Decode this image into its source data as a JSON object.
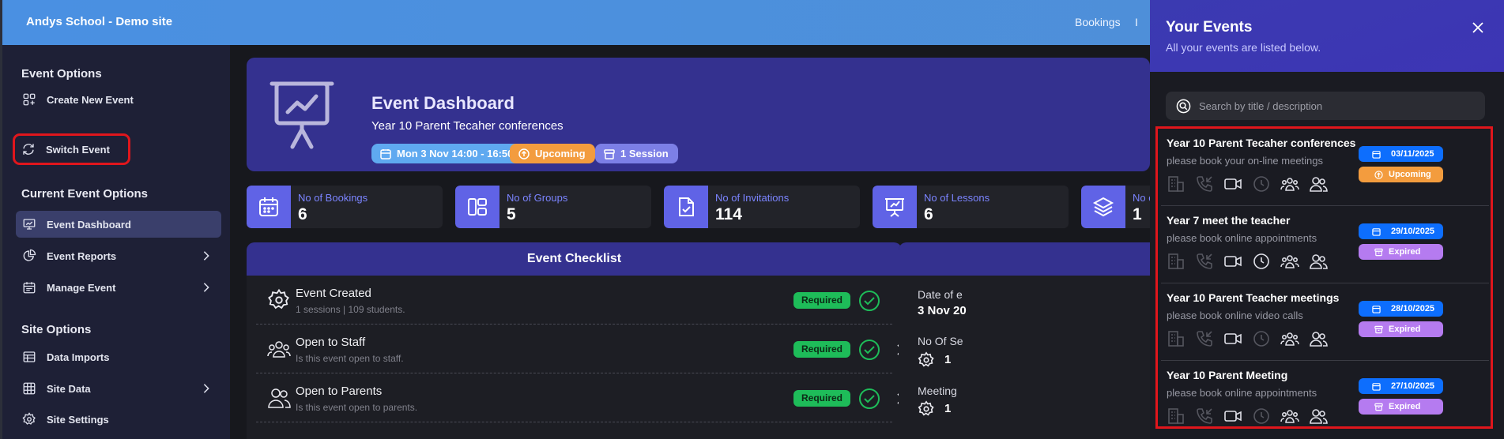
{
  "topbar": {
    "brand": "Andys School - Demo site",
    "nav_bookings": "Bookings",
    "nav_partial": "I"
  },
  "sidebar": {
    "event_options_heading": "Event Options",
    "create_new_event": "Create New Event",
    "switch_event": "Switch Event",
    "current_event_options_heading": "Current Event Options",
    "event_dashboard": "Event Dashboard",
    "event_reports": "Event Reports",
    "manage_event": "Manage Event",
    "site_options_heading": "Site Options",
    "data_imports": "Data Imports",
    "site_data": "Site Data",
    "site_settings": "Site Settings"
  },
  "hero": {
    "title": "Event Dashboard",
    "subtitle": "Year 10 Parent Tecaher conferences",
    "date_pill": "Mon 3 Nov 14:00 - 16:50",
    "status_pill": "Upcoming",
    "session_pill": "1 Session"
  },
  "stats": [
    {
      "label": "No of Bookings",
      "value": "6"
    },
    {
      "label": "No of Groups",
      "value": "5"
    },
    {
      "label": "No of Invitations",
      "value": "114"
    },
    {
      "label": "No of Lessons",
      "value": "6"
    },
    {
      "label": "No o",
      "value": "1"
    }
  ],
  "checklist": {
    "title": "Event Checklist",
    "rows": [
      {
        "title": "Event Created",
        "desc": "1 sessions | 109 students.",
        "badge": "Required"
      },
      {
        "title": "Open to Staff",
        "desc": "Is this event open to staff.",
        "badge": "Required"
      },
      {
        "title": "Open to Parents",
        "desc": "Is this event open to parents.",
        "badge": "Required"
      }
    ]
  },
  "details": {
    "date_label": "Date of e",
    "date_value": "3 Nov 20",
    "sessions_label": "No Of Se",
    "sessions_value": "1",
    "meeting_label": "Meeting",
    "meeting_value": "1"
  },
  "drawer": {
    "title": "Your Events",
    "subtitle": "All your events are listed below.",
    "search_placeholder": "Search by title / description",
    "events": [
      {
        "title": "Year 10 Parent Tecaher conferences",
        "desc": "please book your on-line meetings",
        "date": "03/11/2025",
        "status": "Upcoming"
      },
      {
        "title": "Year 7 meet the teacher",
        "desc": "please book online appointments",
        "date": "29/10/2025",
        "status": "Expired"
      },
      {
        "title": "Year 10 Parent Teacher meetings",
        "desc": "please book online video calls",
        "date": "28/10/2025",
        "status": "Expired"
      },
      {
        "title": "Year 10 Parent Meeting",
        "desc": "please book online appointments",
        "date": "27/10/2025",
        "status": "Expired"
      }
    ]
  },
  "colors": {
    "accent": "#34318f",
    "topbar": "#4a90e2",
    "required": "#1ebc59",
    "upcoming": "#f39c3e",
    "expired": "#b57bf0",
    "date_badge": "#0d6efd",
    "highlight": "#e0161c"
  }
}
